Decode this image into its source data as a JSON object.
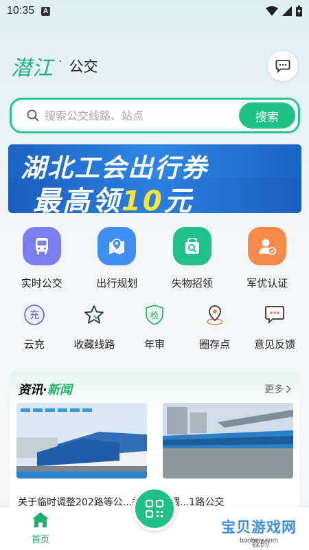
{
  "status": {
    "time": "10:35",
    "badge": "A"
  },
  "header": {
    "brand": "潜江",
    "dot": "·",
    "subtitle": "公交"
  },
  "search": {
    "placeholder": "搜索公交线路、站点",
    "button": "搜索"
  },
  "banner": {
    "line1": "湖北工会出行券",
    "line2_prefix": "最高领",
    "line2_highlight": "10",
    "line2_suffix": "元"
  },
  "main_features": [
    {
      "label": "实时公交",
      "icon": "bus-icon",
      "color": "#7b7ef0"
    },
    {
      "label": "出行规划",
      "icon": "map-pin-icon",
      "color": "#3f8ef2"
    },
    {
      "label": "失物招领",
      "icon": "lost-found-icon",
      "color": "#1fc08a"
    },
    {
      "label": "军优认证",
      "icon": "user-verify-icon",
      "color": "#f58a4a"
    }
  ],
  "sub_features": [
    {
      "label": "云充",
      "icon": "recharge-icon",
      "glyph": "充"
    },
    {
      "label": "收藏线路",
      "icon": "star-icon"
    },
    {
      "label": "年审",
      "icon": "annual-review-icon",
      "glyph": "检"
    },
    {
      "label": "圈存点",
      "icon": "location-icon"
    },
    {
      "label": "意见反馈",
      "icon": "feedback-icon"
    }
  ],
  "news": {
    "title_a": "资讯",
    "title_dot": "·",
    "title_b": "新闻",
    "more": "更多",
    "headline": "关于临时调整202路等公...关于临时调...1路公交"
  },
  "tabbar": {
    "home": "首页",
    "me": "我的"
  },
  "watermark": {
    "main": "宝贝游戏网",
    "sub": "baobeiy.com"
  },
  "colors": {
    "accent": "#1ec185",
    "brand_green": "#21b07a"
  }
}
